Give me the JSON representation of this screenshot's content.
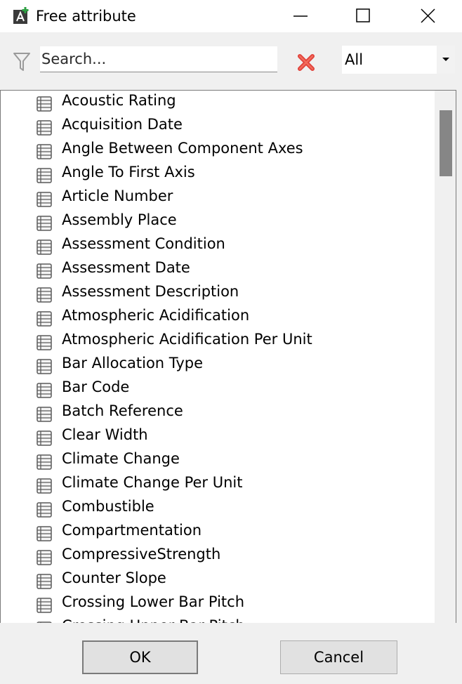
{
  "window": {
    "title": "Free attribute",
    "app_icon": "attribute-add-icon",
    "controls": [
      "minimize-icon",
      "maximize-icon",
      "close-icon"
    ]
  },
  "toolbar": {
    "filter_icon": "filter-icon",
    "search_placeholder": "Search...",
    "search_value": "",
    "clear_icon": "clear-x-icon",
    "category_select": {
      "selected": "All"
    }
  },
  "attributes": [
    {
      "label": "Acoustic Rating",
      "icon": "attribute-list-icon"
    },
    {
      "label": "Acquisition Date",
      "icon": "attribute-list-icon"
    },
    {
      "label": "Angle Between Component Axes",
      "icon": "attribute-list-icon"
    },
    {
      "label": "Angle To First Axis",
      "icon": "attribute-list-icon"
    },
    {
      "label": "Article Number",
      "icon": "attribute-list-icon"
    },
    {
      "label": "Assembly Place",
      "icon": "attribute-list-icon"
    },
    {
      "label": "Assessment Condition",
      "icon": "attribute-list-icon"
    },
    {
      "label": "Assessment Date",
      "icon": "attribute-list-icon"
    },
    {
      "label": "Assessment Description",
      "icon": "attribute-list-icon"
    },
    {
      "label": "Atmospheric Acidification",
      "icon": "attribute-list-icon"
    },
    {
      "label": "Atmospheric Acidification Per Unit",
      "icon": "attribute-list-icon"
    },
    {
      "label": "Bar Allocation Type",
      "icon": "attribute-list-icon"
    },
    {
      "label": "Bar Code",
      "icon": "attribute-list-icon"
    },
    {
      "label": "Batch Reference",
      "icon": "attribute-list-icon"
    },
    {
      "label": "Clear Width",
      "icon": "attribute-list-icon"
    },
    {
      "label": "Climate Change",
      "icon": "attribute-list-icon"
    },
    {
      "label": "Climate Change Per Unit",
      "icon": "attribute-list-icon"
    },
    {
      "label": "Combustible",
      "icon": "attribute-list-icon"
    },
    {
      "label": "Compartmentation",
      "icon": "attribute-list-icon"
    },
    {
      "label": "CompressiveStrength",
      "icon": "attribute-list-icon"
    },
    {
      "label": "Counter Slope",
      "icon": "attribute-list-icon"
    },
    {
      "label": "Crossing Lower Bar Pitch",
      "icon": "attribute-list-icon"
    },
    {
      "label": "Crossing Upper Bar Pitch",
      "icon": "attribute-list-icon"
    }
  ],
  "footer": {
    "ok_label": "OK",
    "cancel_label": "Cancel"
  },
  "colors": {
    "clear_icon": "#e0413a",
    "scrollbar_thumb": "#868686",
    "dialog_background": "#f0f0f0"
  }
}
